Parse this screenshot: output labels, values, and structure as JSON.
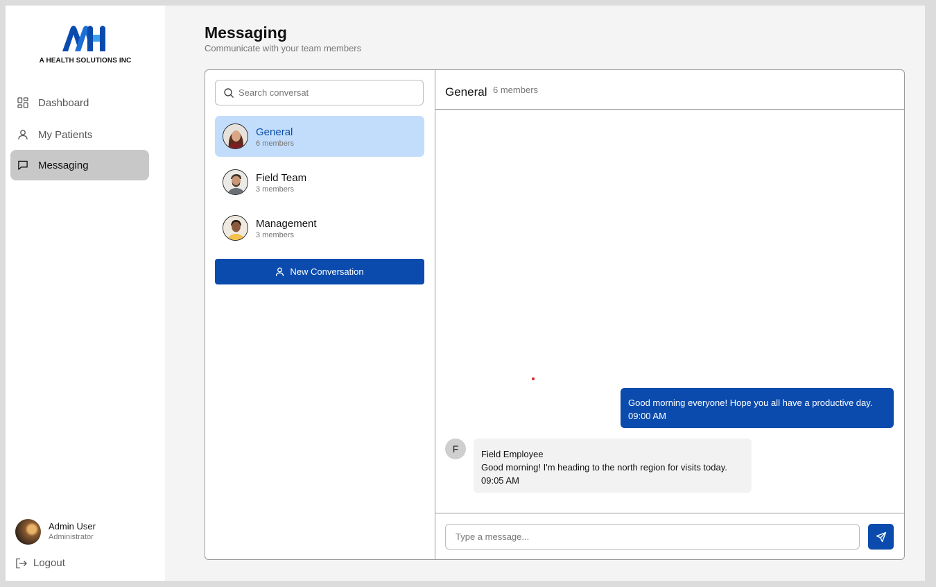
{
  "brand": {
    "company_name": "A HEALTH SOLUTIONS INC",
    "primary_color": "#0a4bad",
    "accent_color": "#3aa0f0"
  },
  "sidebar": {
    "items": [
      {
        "label": "Dashboard",
        "icon": "dashboard-icon",
        "active": false
      },
      {
        "label": "My Patients",
        "icon": "user-icon",
        "active": false
      },
      {
        "label": "Messaging",
        "icon": "message-icon",
        "active": true
      }
    ],
    "user": {
      "name": "Admin User",
      "role": "Administrator"
    },
    "logout_label": "Logout"
  },
  "header": {
    "title": "Messaging",
    "subtitle": "Communicate with your team members"
  },
  "conversations": {
    "search_placeholder": "Search conversat",
    "items": [
      {
        "name": "General",
        "members": "6 members",
        "active": true
      },
      {
        "name": "Field Team",
        "members": "3 members",
        "active": false
      },
      {
        "name": "Management",
        "members": "3 members",
        "active": false
      }
    ],
    "new_button_label": "New Conversation"
  },
  "chat": {
    "title": "General",
    "members": "6 members",
    "messages": [
      {
        "direction": "outgoing",
        "text": "Good morning everyone! Hope you all have a productive day.",
        "time": "09:00 AM"
      },
      {
        "direction": "incoming",
        "avatar_initial": "F",
        "sender": "Field Employee",
        "text": "Good morning! I'm heading to the north region for visits today.",
        "time": "09:05 AM"
      }
    ],
    "input_placeholder": "Type a message..."
  }
}
